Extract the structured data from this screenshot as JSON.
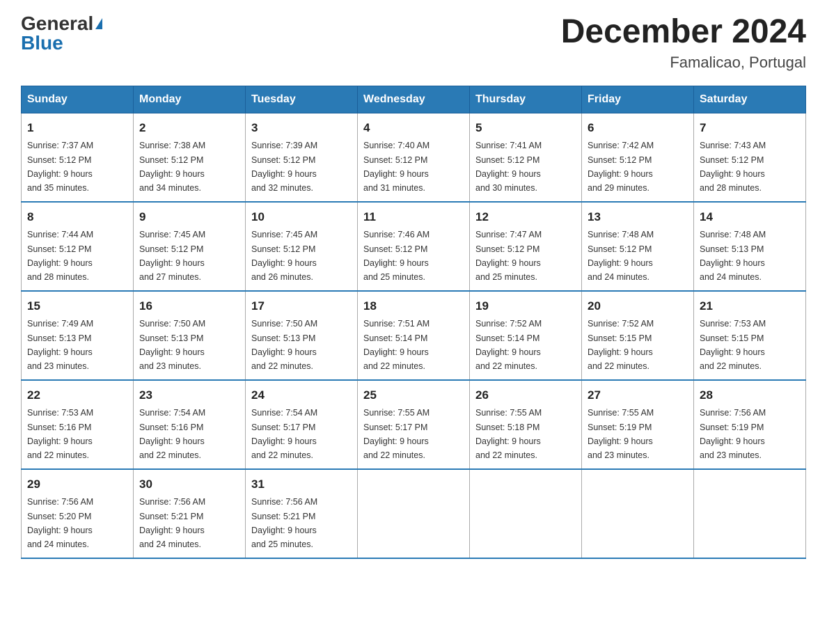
{
  "header": {
    "logo_general": "General",
    "logo_blue": "Blue",
    "month_year": "December 2024",
    "location": "Famalicao, Portugal"
  },
  "days_of_week": [
    "Sunday",
    "Monday",
    "Tuesday",
    "Wednesday",
    "Thursday",
    "Friday",
    "Saturday"
  ],
  "weeks": [
    [
      {
        "day": "1",
        "sunrise": "7:37 AM",
        "sunset": "5:12 PM",
        "daylight": "9 hours and 35 minutes."
      },
      {
        "day": "2",
        "sunrise": "7:38 AM",
        "sunset": "5:12 PM",
        "daylight": "9 hours and 34 minutes."
      },
      {
        "day": "3",
        "sunrise": "7:39 AM",
        "sunset": "5:12 PM",
        "daylight": "9 hours and 32 minutes."
      },
      {
        "day": "4",
        "sunrise": "7:40 AM",
        "sunset": "5:12 PM",
        "daylight": "9 hours and 31 minutes."
      },
      {
        "day": "5",
        "sunrise": "7:41 AM",
        "sunset": "5:12 PM",
        "daylight": "9 hours and 30 minutes."
      },
      {
        "day": "6",
        "sunrise": "7:42 AM",
        "sunset": "5:12 PM",
        "daylight": "9 hours and 29 minutes."
      },
      {
        "day": "7",
        "sunrise": "7:43 AM",
        "sunset": "5:12 PM",
        "daylight": "9 hours and 28 minutes."
      }
    ],
    [
      {
        "day": "8",
        "sunrise": "7:44 AM",
        "sunset": "5:12 PM",
        "daylight": "9 hours and 28 minutes."
      },
      {
        "day": "9",
        "sunrise": "7:45 AM",
        "sunset": "5:12 PM",
        "daylight": "9 hours and 27 minutes."
      },
      {
        "day": "10",
        "sunrise": "7:45 AM",
        "sunset": "5:12 PM",
        "daylight": "9 hours and 26 minutes."
      },
      {
        "day": "11",
        "sunrise": "7:46 AM",
        "sunset": "5:12 PM",
        "daylight": "9 hours and 25 minutes."
      },
      {
        "day": "12",
        "sunrise": "7:47 AM",
        "sunset": "5:12 PM",
        "daylight": "9 hours and 25 minutes."
      },
      {
        "day": "13",
        "sunrise": "7:48 AM",
        "sunset": "5:12 PM",
        "daylight": "9 hours and 24 minutes."
      },
      {
        "day": "14",
        "sunrise": "7:48 AM",
        "sunset": "5:13 PM",
        "daylight": "9 hours and 24 minutes."
      }
    ],
    [
      {
        "day": "15",
        "sunrise": "7:49 AM",
        "sunset": "5:13 PM",
        "daylight": "9 hours and 23 minutes."
      },
      {
        "day": "16",
        "sunrise": "7:50 AM",
        "sunset": "5:13 PM",
        "daylight": "9 hours and 23 minutes."
      },
      {
        "day": "17",
        "sunrise": "7:50 AM",
        "sunset": "5:13 PM",
        "daylight": "9 hours and 22 minutes."
      },
      {
        "day": "18",
        "sunrise": "7:51 AM",
        "sunset": "5:14 PM",
        "daylight": "9 hours and 22 minutes."
      },
      {
        "day": "19",
        "sunrise": "7:52 AM",
        "sunset": "5:14 PM",
        "daylight": "9 hours and 22 minutes."
      },
      {
        "day": "20",
        "sunrise": "7:52 AM",
        "sunset": "5:15 PM",
        "daylight": "9 hours and 22 minutes."
      },
      {
        "day": "21",
        "sunrise": "7:53 AM",
        "sunset": "5:15 PM",
        "daylight": "9 hours and 22 minutes."
      }
    ],
    [
      {
        "day": "22",
        "sunrise": "7:53 AM",
        "sunset": "5:16 PM",
        "daylight": "9 hours and 22 minutes."
      },
      {
        "day": "23",
        "sunrise": "7:54 AM",
        "sunset": "5:16 PM",
        "daylight": "9 hours and 22 minutes."
      },
      {
        "day": "24",
        "sunrise": "7:54 AM",
        "sunset": "5:17 PM",
        "daylight": "9 hours and 22 minutes."
      },
      {
        "day": "25",
        "sunrise": "7:55 AM",
        "sunset": "5:17 PM",
        "daylight": "9 hours and 22 minutes."
      },
      {
        "day": "26",
        "sunrise": "7:55 AM",
        "sunset": "5:18 PM",
        "daylight": "9 hours and 22 minutes."
      },
      {
        "day": "27",
        "sunrise": "7:55 AM",
        "sunset": "5:19 PM",
        "daylight": "9 hours and 23 minutes."
      },
      {
        "day": "28",
        "sunrise": "7:56 AM",
        "sunset": "5:19 PM",
        "daylight": "9 hours and 23 minutes."
      }
    ],
    [
      {
        "day": "29",
        "sunrise": "7:56 AM",
        "sunset": "5:20 PM",
        "daylight": "9 hours and 24 minutes."
      },
      {
        "day": "30",
        "sunrise": "7:56 AM",
        "sunset": "5:21 PM",
        "daylight": "9 hours and 24 minutes."
      },
      {
        "day": "31",
        "sunrise": "7:56 AM",
        "sunset": "5:21 PM",
        "daylight": "9 hours and 25 minutes."
      },
      null,
      null,
      null,
      null
    ]
  ],
  "labels": {
    "sunrise": "Sunrise:",
    "sunset": "Sunset:",
    "daylight": "Daylight:"
  }
}
